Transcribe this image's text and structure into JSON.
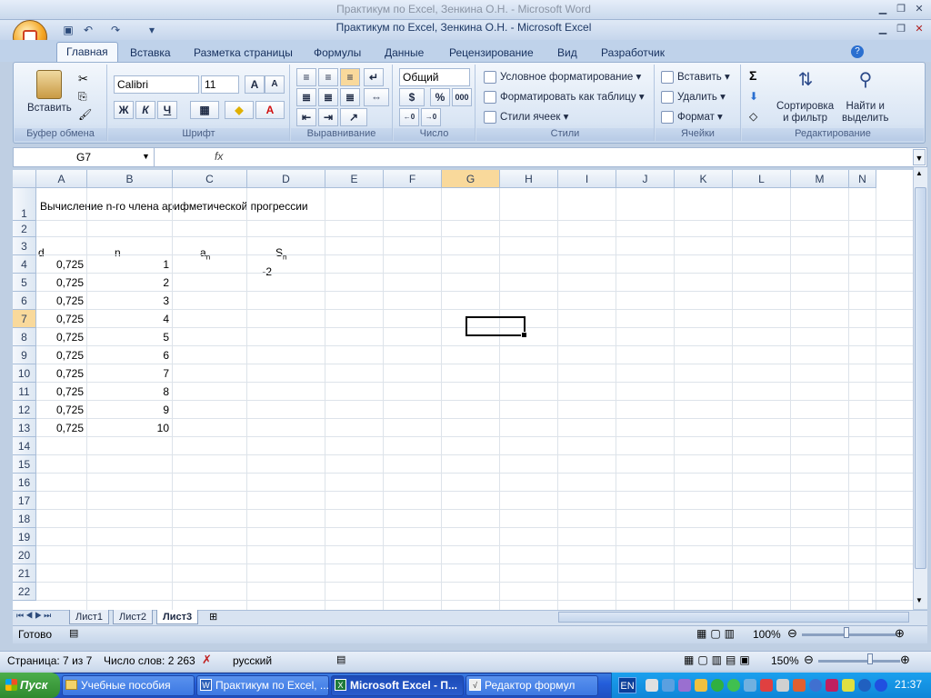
{
  "word_window_title": "Практикум по Excel, Зенкина О.Н. - Microsoft Word",
  "excel_window_title": "Практикум по Excel, Зенкина О.Н. - Microsoft Excel",
  "ribbon_tabs": [
    "Главная",
    "Вставка",
    "Разметка страницы",
    "Формулы",
    "Данные",
    "Рецензирование",
    "Вид",
    "Разработчик"
  ],
  "clipboard": {
    "paste": "Вставить",
    "group": "Буфер обмена"
  },
  "font": {
    "name": "Calibri",
    "size": "11",
    "bold": "Ж",
    "italic": "К",
    "underline": "Ч",
    "grow": "A",
    "shrink": "A",
    "color_letter": "A",
    "group": "Шрифт"
  },
  "alignment": {
    "group": "Выравнивание"
  },
  "number": {
    "format": "Общий",
    "percent": "%",
    "thousands": "000",
    "inc_dec": ",0\n,00",
    "group": "Число"
  },
  "styles": {
    "conditional": "Условное форматирование",
    "as_table": "Форматировать как таблицу",
    "cell_styles": "Стили ячеек",
    "group": "Стили"
  },
  "cells": {
    "insert": "Вставить",
    "delete": "Удалить",
    "format": "Формат",
    "group": "Ячейки"
  },
  "editing": {
    "sigma": "Σ",
    "sort": "Сортировка\nи фильтр",
    "find": "Найти и\nвыделить",
    "group": "Редактирование"
  },
  "name_box": "G7",
  "fx_label": "fx",
  "columns": [
    "A",
    "B",
    "C",
    "D",
    "E",
    "F",
    "G",
    "H",
    "I",
    "J",
    "K",
    "L",
    "M",
    "N"
  ],
  "rows": [
    "1",
    "2",
    "3",
    "4",
    "5",
    "6",
    "7",
    "8",
    "9",
    "10",
    "11",
    "12",
    "13",
    "14",
    "15",
    "16",
    "17",
    "18",
    "19",
    "20",
    "21",
    "22"
  ],
  "sheet": {
    "a1": "Вычисление n-го члена арифметической прогрессии",
    "a3": "d",
    "b3": "n",
    "c3": "a",
    "c3_sub": "n",
    "d3": "S",
    "d3_sub": "n",
    "c4": "-2",
    "col_a": [
      "0,725",
      "0,725",
      "0,725",
      "0,725",
      "0,725",
      "0,725",
      "0,725",
      "0,725",
      "0,725",
      "0,725"
    ],
    "col_b": [
      "1",
      "2",
      "3",
      "4",
      "5",
      "6",
      "7",
      "8",
      "9",
      "10"
    ]
  },
  "sheet_tabs": [
    "Лист1",
    "Лист2",
    "Лист3"
  ],
  "status": {
    "ready": "Готово",
    "zoom": "100%"
  },
  "word_status": {
    "page": "Страница: 7 из 7",
    "words": "Число слов: 2 263",
    "lang": "русский",
    "zoom": "150%"
  },
  "taskbar": {
    "start": "Пуск",
    "items": [
      "Учебные пособия",
      "Практикум по Excel, ...",
      "Microsoft Excel - П...",
      "Редактор формул"
    ],
    "lang": "EN",
    "clock": "21:37"
  }
}
